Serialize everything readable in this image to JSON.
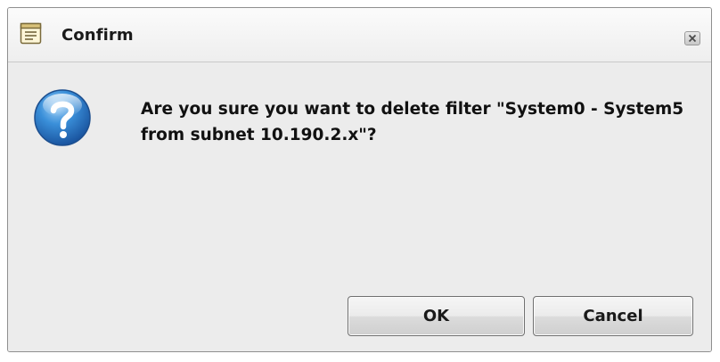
{
  "dialog": {
    "title": "Confirm",
    "title_icon": "document-icon",
    "close_icon": "close-icon",
    "question_icon": "question-icon",
    "message": "Are you sure you want to delete filter \"System0 - System5 from subnet 10.190.2.x\"?",
    "buttons": {
      "ok_label": "OK",
      "cancel_label": "Cancel"
    }
  }
}
